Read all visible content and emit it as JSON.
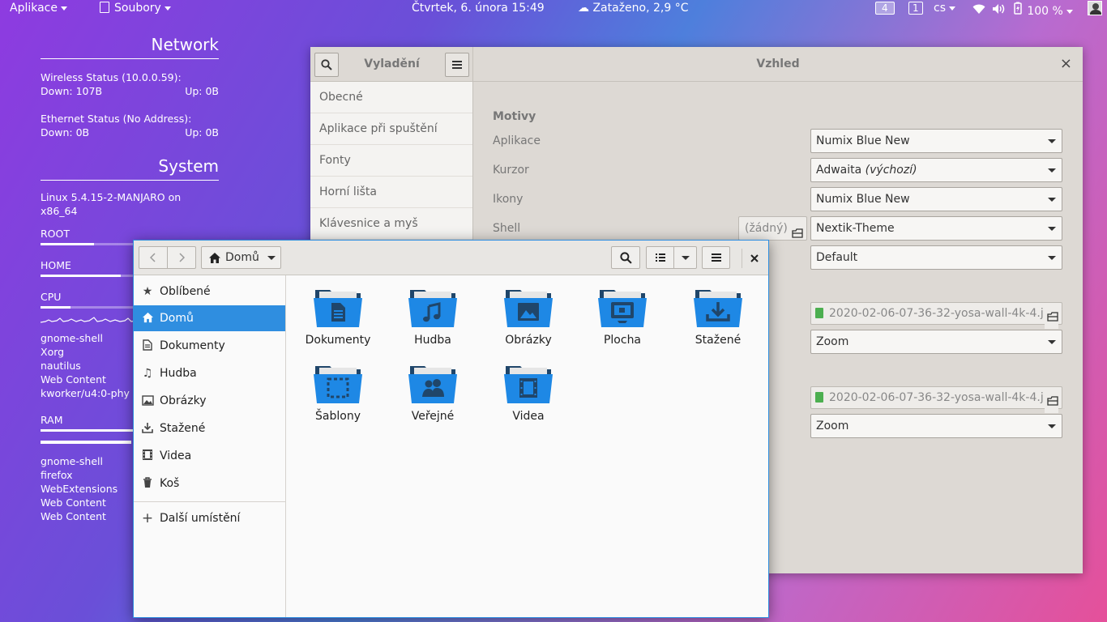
{
  "topbar": {
    "apps_label": "Aplikace",
    "files_label": "Soubory",
    "clock": "Čtvrtek, 6. února  15:49",
    "weather": "Zataženo, 2,9 °C",
    "workspace_count": "4",
    "workspace_current": "1",
    "keyboard_layout": "cs",
    "battery": "100 %"
  },
  "conky": {
    "network_title": "Network",
    "wireless_status": "Wireless Status (10.0.0.59):",
    "wireless_down": "Down: 107B",
    "wireless_up": "Up: 0B",
    "ethernet_status": "Ethernet Status (No Address):",
    "ethernet_down": "Down: 0B",
    "ethernet_up": "Up: 0B",
    "system_title": "System",
    "kernel": "Linux 5.4.15-2-MANJARO on x86_64",
    "root_label": "ROOT",
    "root_usage": 0.3,
    "home_label": "HOME",
    "home_usage": 0.45,
    "cpu_label": "CPU",
    "cpu_usage": 0.17,
    "cpu_processes": [
      "gnome-shell",
      "Xorg",
      "nautilus",
      "Web Content",
      "kworker/u4:0-phy"
    ],
    "ram_label": "RAM",
    "ram_usage": 0.52,
    "ram_processes": [
      "gnome-shell",
      "firefox",
      "WebExtensions",
      "Web Content",
      "Web Content"
    ]
  },
  "tweaks": {
    "sidebar_title": "Vyladění",
    "page_title": "Vzhled",
    "sidebar_items": [
      "Obecné",
      "Aplikace při spuštění",
      "Fonty",
      "Horní lišta",
      "Klávesnice a myš"
    ],
    "section_themes": "Motivy",
    "row_applications": "Aplikace",
    "row_cursor": "Kurzor",
    "row_icons": "Ikony",
    "row_shell": "Shell",
    "applications_value": "Numix Blue New",
    "cursor_value": "Adwaita",
    "cursor_default": "(výchozí)",
    "icons_value": "Numix Blue New",
    "shell_none": "(žádný)",
    "shell_value": "Nextik-Theme",
    "sound_value": "Default",
    "background_file": "2020-02-06-07-36-32-yosa-wall-4k-4.jpg",
    "background_adjust": "Zoom",
    "lockscreen_file": "2020-02-06-07-36-32-yosa-wall-4k-4.jpg",
    "lockscreen_adjust": "Zoom"
  },
  "files": {
    "location": "Domů",
    "sidebar": {
      "starred": "Oblíbené",
      "home": "Domů",
      "documents": "Dokumenty",
      "music": "Hudba",
      "pictures": "Obrázky",
      "downloads": "Stažené",
      "videos": "Videa",
      "trash": "Koš",
      "other": "Další umístění"
    },
    "folders": {
      "documents": "Dokumenty",
      "music": "Hudba",
      "pictures": "Obrázky",
      "desktop": "Plocha",
      "downloads": "Stažené",
      "templates": "Šablony",
      "public": "Veřejné",
      "videos": "Videa"
    }
  },
  "colors": {
    "accent": "#2f8ee0",
    "folder_blue": "#1e88e5",
    "folder_dark": "#20466a"
  }
}
